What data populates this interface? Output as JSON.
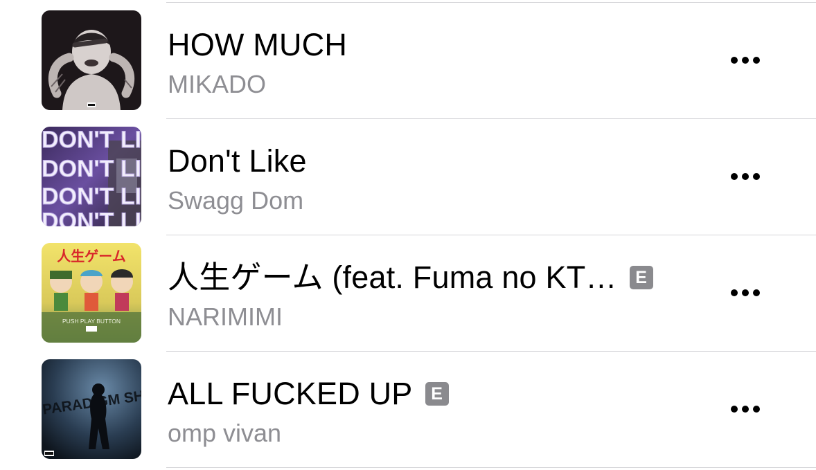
{
  "songs": [
    {
      "title": "HOW MUCH",
      "artist": "MIKADO",
      "explicit": false,
      "artwork_icon": "album-artwork"
    },
    {
      "title": "Don't Like",
      "artist": "Swagg Dom",
      "explicit": false,
      "artwork_icon": "album-artwork",
      "artwork_text": "DON'T LIKE"
    },
    {
      "title": "人生ゲーム (feat. Fuma no KT…",
      "artist": "NARIMIMI",
      "explicit": true,
      "explicit_label": "E",
      "artwork_icon": "album-artwork",
      "artwork_text": "人生ゲーム",
      "artwork_subtext": "PUSH PLAY BUTTON"
    },
    {
      "title": "ALL FUCKED UP",
      "artist": "omp vivan",
      "explicit": true,
      "explicit_label": "E",
      "artwork_icon": "album-artwork",
      "artwork_text": "PARADIGM SHIFT"
    }
  ],
  "more_icon": "ellipsis-icon",
  "colors": {
    "title": "#000000",
    "artist": "#8e8e93",
    "explicit_badge": "#8a8a8e",
    "separator": "#d4d4d8"
  }
}
